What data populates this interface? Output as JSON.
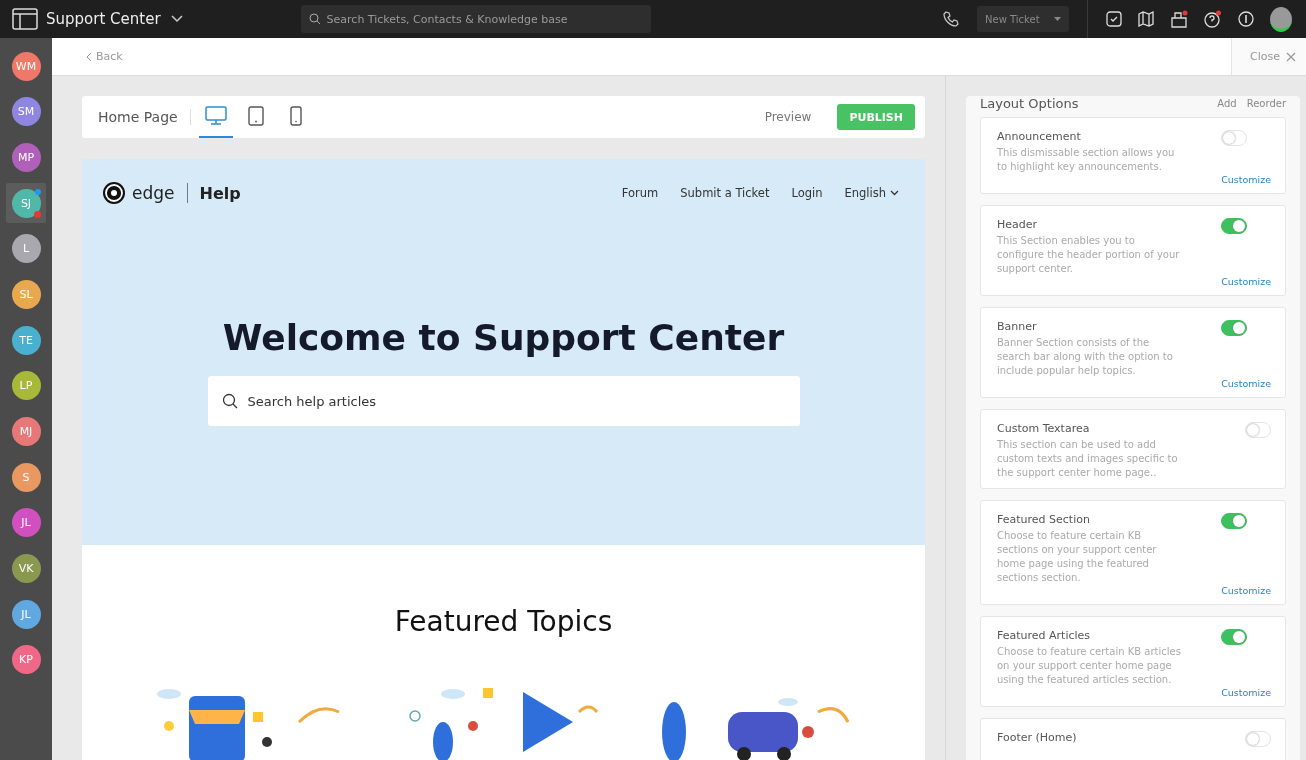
{
  "topbar": {
    "title": "Support Center",
    "search": {
      "placeholder": "Search Tickets, Contacts & Knowledge base"
    },
    "new_ticket": "New Ticket"
  },
  "agents": [
    {
      "initials": "WM",
      "color": "#f07868",
      "selected": false,
      "unread": false,
      "busy": false
    },
    {
      "initials": "SM",
      "color": "#8e86e0",
      "selected": false,
      "unread": false,
      "busy": false
    },
    {
      "initials": "MP",
      "color": "#b060b8",
      "selected": false,
      "unread": false,
      "busy": false
    },
    {
      "initials": "SJ",
      "color": "#4fb8a8",
      "selected": true,
      "unread": true,
      "busy": true
    },
    {
      "initials": "L",
      "color": "#a8a8ae",
      "selected": false,
      "unread": false,
      "busy": false
    },
    {
      "initials": "SL",
      "color": "#e8a850",
      "selected": false,
      "unread": false,
      "busy": false
    },
    {
      "initials": "TE",
      "color": "#4ab0d0",
      "selected": false,
      "unread": false,
      "busy": false
    },
    {
      "initials": "LP",
      "color": "#a8b838",
      "selected": false,
      "unread": false,
      "busy": false
    },
    {
      "initials": "MJ",
      "color": "#e87878",
      "selected": false,
      "unread": false,
      "busy": false
    },
    {
      "initials": "S",
      "color": "#e89860",
      "selected": false,
      "unread": false,
      "busy": false
    },
    {
      "initials": "JL",
      "color": "#d050c0",
      "selected": false,
      "unread": false,
      "busy": false
    },
    {
      "initials": "VK",
      "color": "#8a9850",
      "selected": false,
      "unread": false,
      "busy": false
    },
    {
      "initials": "JL",
      "color": "#60a8e0",
      "selected": false,
      "unread": false,
      "busy": false
    },
    {
      "initials": "KP",
      "color": "#f06888",
      "selected": false,
      "unread": false,
      "busy": false
    }
  ],
  "subbar": {
    "back": "Back",
    "close": "Close"
  },
  "editor": {
    "page_title": "Home Page",
    "devices": [
      {
        "kind": "desktop",
        "selected": true
      },
      {
        "kind": "tablet",
        "selected": false
      },
      {
        "kind": "phone",
        "selected": false
      }
    ],
    "preview": "Preview",
    "publish": "PUBLISH",
    "site": {
      "brand": "edge",
      "section": "Help",
      "nav": [
        "Forum",
        "Submit a Ticket",
        "Login"
      ],
      "language": "English",
      "heading": "Welcome to Support Center",
      "search": {
        "placeholder": "Search help articles"
      },
      "featured_title": "Featured Topics"
    }
  },
  "layout_panel": {
    "title": "Layout Options",
    "actions": [
      "Add",
      "Reorder"
    ],
    "sections": [
      {
        "title": "Announcement",
        "description": "This dismissable section allows you to highlight key announcements.",
        "on": false,
        "action": "Customize"
      },
      {
        "title": "Header",
        "description": "This Section enables you to configure the header portion of your support center.",
        "on": true,
        "action": "Customize"
      },
      {
        "title": "Banner",
        "description": "Banner Section consists of the search bar along with the option to include popular help topics.",
        "on": true,
        "action": "Customize"
      },
      {
        "title": "Custom Textarea",
        "description": "This section can be used to add custom texts and images specific to the support center home page..",
        "on": false
      },
      {
        "title": "Featured Section",
        "description": "Choose to feature certain KB sections on your support center home page using the featured sections section.",
        "on": true,
        "action": "Customize"
      },
      {
        "title": "Featured Articles",
        "description": "Choose to feature certain KB articles on your support center home page using the featured articles section.",
        "on": true,
        "action": "Customize"
      },
      {
        "title": "Footer (Home)",
        "on": false
      }
    ]
  }
}
